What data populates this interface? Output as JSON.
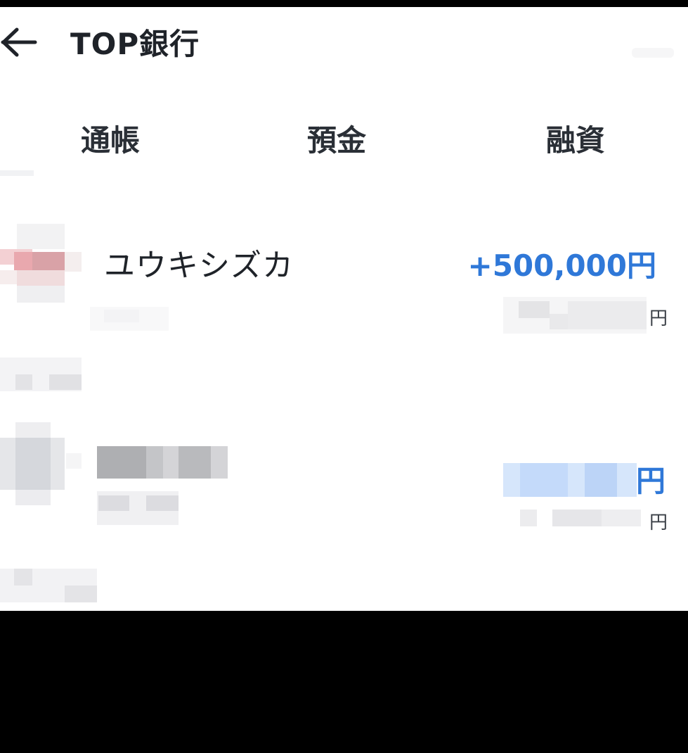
{
  "header": {
    "back_icon": "arrow-left-icon",
    "title": "TOP銀行"
  },
  "tabs": [
    {
      "label": "通帳"
    },
    {
      "label": "預金"
    },
    {
      "label": "融資"
    }
  ],
  "transactions": [
    {
      "name": "ユウキシズカ",
      "amount": "+500,000円",
      "balance_unit": "円"
    },
    {
      "amount_unit": "円",
      "balance_unit": "円"
    }
  ],
  "colors": {
    "accent_blue": "#2f78d8",
    "text_dark": "#1f2329",
    "background": "#ffffff",
    "frame": "#000000"
  }
}
